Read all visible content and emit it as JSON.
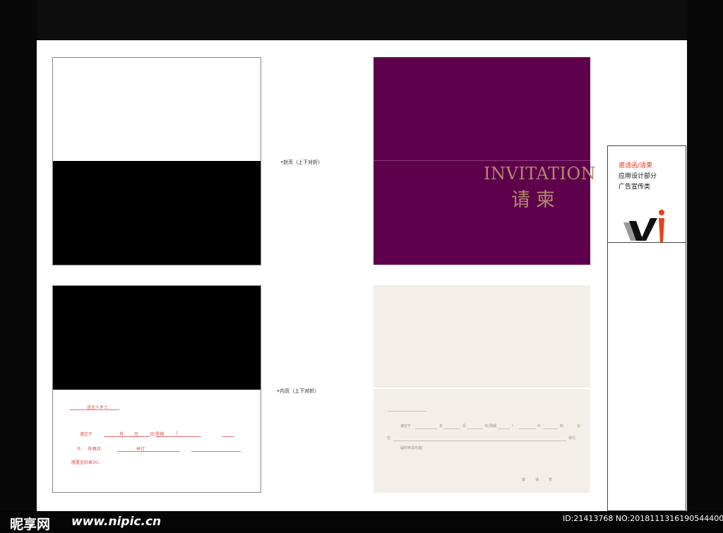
{
  "notes": {
    "cover": "•封页（上下对折）",
    "inner": "•内页（上下对折）"
  },
  "cover_design": {
    "title_en": "INVITATION",
    "title_cn": "请柬"
  },
  "inner_template": {
    "line1": "送达人乡士:",
    "line2_parts": [
      "谨定于",
      "世",
      "月",
      "日(星期",
      ")"
    ],
    "line3_parts": [
      "午",
      "陈春花",
      "举行"
    ],
    "line4": "隆重宣机泰30。"
  },
  "inner_design": {
    "line1_parts": [
      "谨定于",
      "年",
      "月",
      "日(周期",
      ")",
      "午",
      "时",
      "分"
    ],
    "line2_left": "在",
    "line2_right": "举行",
    "line3": "届时恭请光临!",
    "sign_parts": [
      "敬",
      "请",
      "赏"
    ]
  },
  "side_panel": {
    "item1": "邀请函/请柬",
    "item2": "应用设计部分",
    "item3": "广告宣传类",
    "logo_v": "V",
    "logo_i": "i",
    "accent_color": "#e8401c"
  },
  "watermark": {
    "brand": "昵享网",
    "site": "www.nipic.cn",
    "id_text": "ID:21413768 NO:20181113161905444000"
  }
}
